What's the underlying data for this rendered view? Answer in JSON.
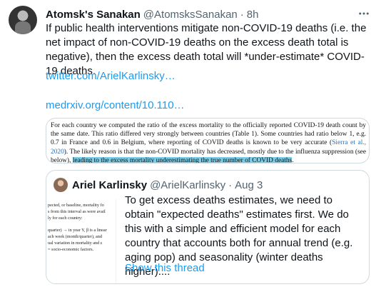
{
  "tweet": {
    "author_name": "Atomsk's Sanakan",
    "author_handle": "@AtomsksSanakan",
    "separator": "·",
    "time": "8h",
    "text": "If public health interventions mitigate non-COVID-19 deaths (i.e. the net impact of non-COVID-19 deaths on the excess death total is negative), then the excess death total will *under-estimate* COVID-19 deaths.",
    "links": [
      "twitter.com/ArielKarlinsky…",
      "medrxiv.org/content/10.110…"
    ],
    "more_icon": "more-options-icon"
  },
  "media": {
    "text_before": "For each country we computed the ratio of the excess mortality to the officially reported COVID-19 death count by the same date. This ratio differed very strongly between countries (Table 1). Some countries had ratio below 1, e.g. 0.7 in France and 0.6 in Belgium, where reporting of COVID deaths is known to be very accurate (",
    "citation": "Sierra et al., 2020",
    "text_middle": "). The likely reason is that the non-COVID mortality has decreased, mostly due to the influenza suppression (see below), ",
    "highlighted": "leading to the excess mortality underestimating the true number of COVID deaths",
    "text_after": ".",
    "highlight_color": "#79cde8"
  },
  "quote": {
    "author_name": "Ariel Karlinsky",
    "author_handle": "@ArielKarlinsky",
    "separator": "·",
    "time": "Aug 3",
    "text": "To get excess deaths estimates, we need to obtain \"expected deaths\" estimates first. We do this with a simple and efficient model for each country that accounts both for annual trend (e.g. aging pop) and seasonality (winter deaths higher)....",
    "show_thread": "Show this thread",
    "thumbnail_lines": [
      "pected, or baseline, mortality fo",
      "s from this interval as were avail",
      "ly for each country:",
      "",
      "quarter) → in year Y, β is a linear",
      "ach week (month/quarter), and",
      "ual variation in mortality and ε",
      "= socio-economic factors."
    ]
  },
  "colors": {
    "link": "#1d9bf0",
    "text": "#0f1419",
    "secondary": "#536471",
    "border": "#cfd9de"
  }
}
